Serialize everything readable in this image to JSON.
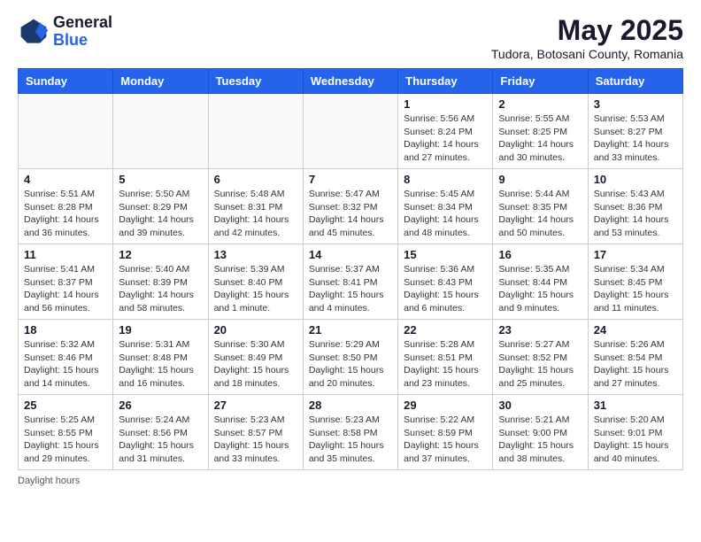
{
  "header": {
    "logo_general": "General",
    "logo_blue": "Blue",
    "month_title": "May 2025",
    "location": "Tudora, Botosani County, Romania"
  },
  "weekdays": [
    "Sunday",
    "Monday",
    "Tuesday",
    "Wednesday",
    "Thursday",
    "Friday",
    "Saturday"
  ],
  "weeks": [
    [
      {
        "day": "",
        "info": ""
      },
      {
        "day": "",
        "info": ""
      },
      {
        "day": "",
        "info": ""
      },
      {
        "day": "",
        "info": ""
      },
      {
        "day": "1",
        "info": "Sunrise: 5:56 AM\nSunset: 8:24 PM\nDaylight: 14 hours\nand 27 minutes."
      },
      {
        "day": "2",
        "info": "Sunrise: 5:55 AM\nSunset: 8:25 PM\nDaylight: 14 hours\nand 30 minutes."
      },
      {
        "day": "3",
        "info": "Sunrise: 5:53 AM\nSunset: 8:27 PM\nDaylight: 14 hours\nand 33 minutes."
      }
    ],
    [
      {
        "day": "4",
        "info": "Sunrise: 5:51 AM\nSunset: 8:28 PM\nDaylight: 14 hours\nand 36 minutes."
      },
      {
        "day": "5",
        "info": "Sunrise: 5:50 AM\nSunset: 8:29 PM\nDaylight: 14 hours\nand 39 minutes."
      },
      {
        "day": "6",
        "info": "Sunrise: 5:48 AM\nSunset: 8:31 PM\nDaylight: 14 hours\nand 42 minutes."
      },
      {
        "day": "7",
        "info": "Sunrise: 5:47 AM\nSunset: 8:32 PM\nDaylight: 14 hours\nand 45 minutes."
      },
      {
        "day": "8",
        "info": "Sunrise: 5:45 AM\nSunset: 8:34 PM\nDaylight: 14 hours\nand 48 minutes."
      },
      {
        "day": "9",
        "info": "Sunrise: 5:44 AM\nSunset: 8:35 PM\nDaylight: 14 hours\nand 50 minutes."
      },
      {
        "day": "10",
        "info": "Sunrise: 5:43 AM\nSunset: 8:36 PM\nDaylight: 14 hours\nand 53 minutes."
      }
    ],
    [
      {
        "day": "11",
        "info": "Sunrise: 5:41 AM\nSunset: 8:37 PM\nDaylight: 14 hours\nand 56 minutes."
      },
      {
        "day": "12",
        "info": "Sunrise: 5:40 AM\nSunset: 8:39 PM\nDaylight: 14 hours\nand 58 minutes."
      },
      {
        "day": "13",
        "info": "Sunrise: 5:39 AM\nSunset: 8:40 PM\nDaylight: 15 hours\nand 1 minute."
      },
      {
        "day": "14",
        "info": "Sunrise: 5:37 AM\nSunset: 8:41 PM\nDaylight: 15 hours\nand 4 minutes."
      },
      {
        "day": "15",
        "info": "Sunrise: 5:36 AM\nSunset: 8:43 PM\nDaylight: 15 hours\nand 6 minutes."
      },
      {
        "day": "16",
        "info": "Sunrise: 5:35 AM\nSunset: 8:44 PM\nDaylight: 15 hours\nand 9 minutes."
      },
      {
        "day": "17",
        "info": "Sunrise: 5:34 AM\nSunset: 8:45 PM\nDaylight: 15 hours\nand 11 minutes."
      }
    ],
    [
      {
        "day": "18",
        "info": "Sunrise: 5:32 AM\nSunset: 8:46 PM\nDaylight: 15 hours\nand 14 minutes."
      },
      {
        "day": "19",
        "info": "Sunrise: 5:31 AM\nSunset: 8:48 PM\nDaylight: 15 hours\nand 16 minutes."
      },
      {
        "day": "20",
        "info": "Sunrise: 5:30 AM\nSunset: 8:49 PM\nDaylight: 15 hours\nand 18 minutes."
      },
      {
        "day": "21",
        "info": "Sunrise: 5:29 AM\nSunset: 8:50 PM\nDaylight: 15 hours\nand 20 minutes."
      },
      {
        "day": "22",
        "info": "Sunrise: 5:28 AM\nSunset: 8:51 PM\nDaylight: 15 hours\nand 23 minutes."
      },
      {
        "day": "23",
        "info": "Sunrise: 5:27 AM\nSunset: 8:52 PM\nDaylight: 15 hours\nand 25 minutes."
      },
      {
        "day": "24",
        "info": "Sunrise: 5:26 AM\nSunset: 8:54 PM\nDaylight: 15 hours\nand 27 minutes."
      }
    ],
    [
      {
        "day": "25",
        "info": "Sunrise: 5:25 AM\nSunset: 8:55 PM\nDaylight: 15 hours\nand 29 minutes."
      },
      {
        "day": "26",
        "info": "Sunrise: 5:24 AM\nSunset: 8:56 PM\nDaylight: 15 hours\nand 31 minutes."
      },
      {
        "day": "27",
        "info": "Sunrise: 5:23 AM\nSunset: 8:57 PM\nDaylight: 15 hours\nand 33 minutes."
      },
      {
        "day": "28",
        "info": "Sunrise: 5:23 AM\nSunset: 8:58 PM\nDaylight: 15 hours\nand 35 minutes."
      },
      {
        "day": "29",
        "info": "Sunrise: 5:22 AM\nSunset: 8:59 PM\nDaylight: 15 hours\nand 37 minutes."
      },
      {
        "day": "30",
        "info": "Sunrise: 5:21 AM\nSunset: 9:00 PM\nDaylight: 15 hours\nand 38 minutes."
      },
      {
        "day": "31",
        "info": "Sunrise: 5:20 AM\nSunset: 9:01 PM\nDaylight: 15 hours\nand 40 minutes."
      }
    ]
  ],
  "footer": {
    "daylight_label": "Daylight hours"
  }
}
